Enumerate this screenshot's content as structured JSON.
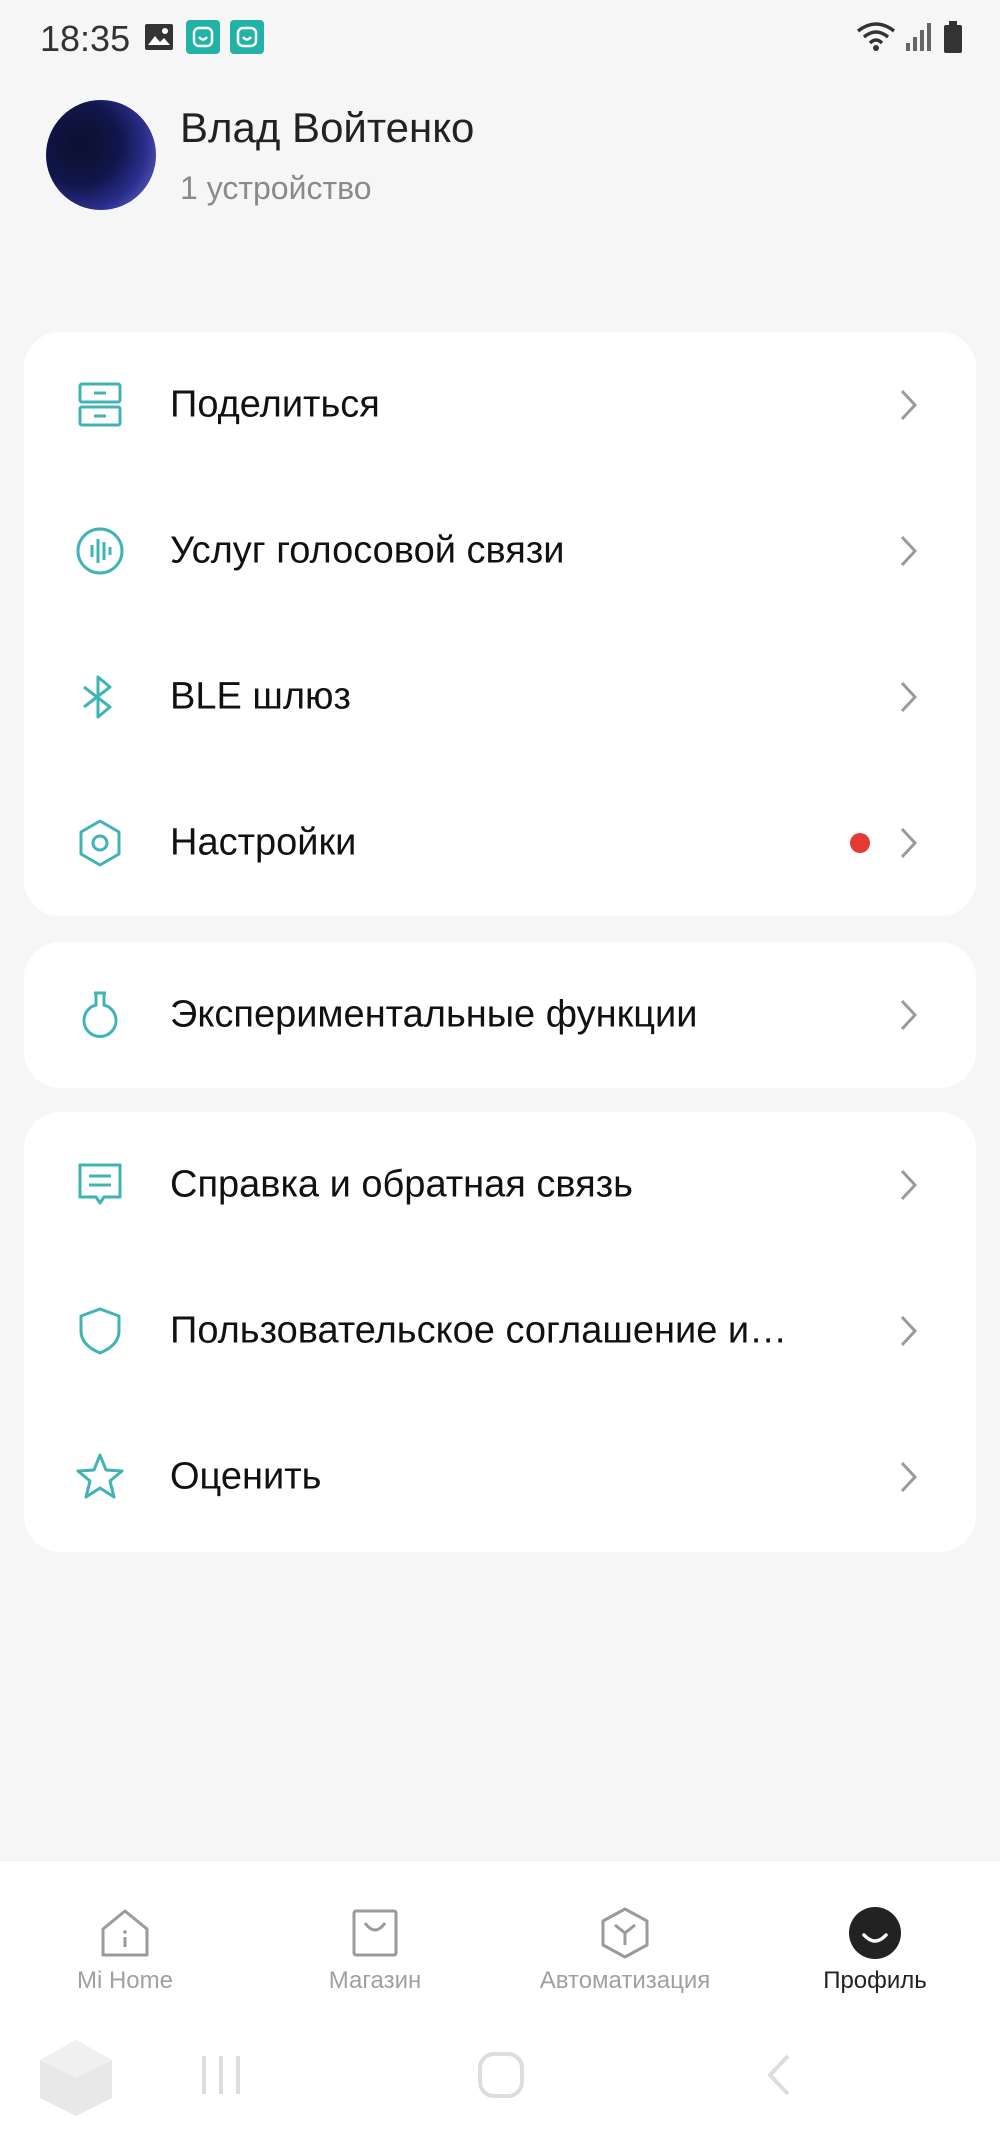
{
  "status_bar": {
    "time": "18:35",
    "left_icons": [
      "image-icon",
      "mi-home-icon",
      "mi-home-icon"
    ],
    "right_icons": [
      "wifi-icon",
      "signal-icon",
      "battery-icon"
    ]
  },
  "profile": {
    "name": "Влад Войтенко",
    "subtitle": "1 устройство"
  },
  "menu_groups": [
    {
      "items": [
        {
          "label": "Поделиться",
          "icon": "share-icon"
        },
        {
          "label": "Услуг голосовой связи",
          "icon": "voice-icon"
        },
        {
          "label": "BLE шлюз",
          "icon": "bluetooth-icon"
        },
        {
          "label": "Настройки",
          "icon": "settings-icon",
          "badge": true
        }
      ]
    },
    {
      "items": [
        {
          "label": "Экспериментальные функции",
          "icon": "flask-icon"
        }
      ]
    },
    {
      "items": [
        {
          "label": "Справка и обратная связь",
          "icon": "feedback-icon"
        },
        {
          "label": "Пользовательское соглашение и…",
          "icon": "shield-icon"
        },
        {
          "label": "Оценить",
          "icon": "star-icon"
        }
      ]
    }
  ],
  "bottom_nav": {
    "items": [
      {
        "label": "Mi Home",
        "icon": "home-icon",
        "active": false
      },
      {
        "label": "Магазин",
        "icon": "shop-icon",
        "active": false
      },
      {
        "label": "Автоматизация",
        "icon": "automation-icon",
        "active": false
      },
      {
        "label": "Профиль",
        "icon": "profile-icon",
        "active": true
      }
    ]
  },
  "colors": {
    "accent": "#3fb3b6",
    "badge": "#e53935",
    "background": "#f6f6f6"
  }
}
